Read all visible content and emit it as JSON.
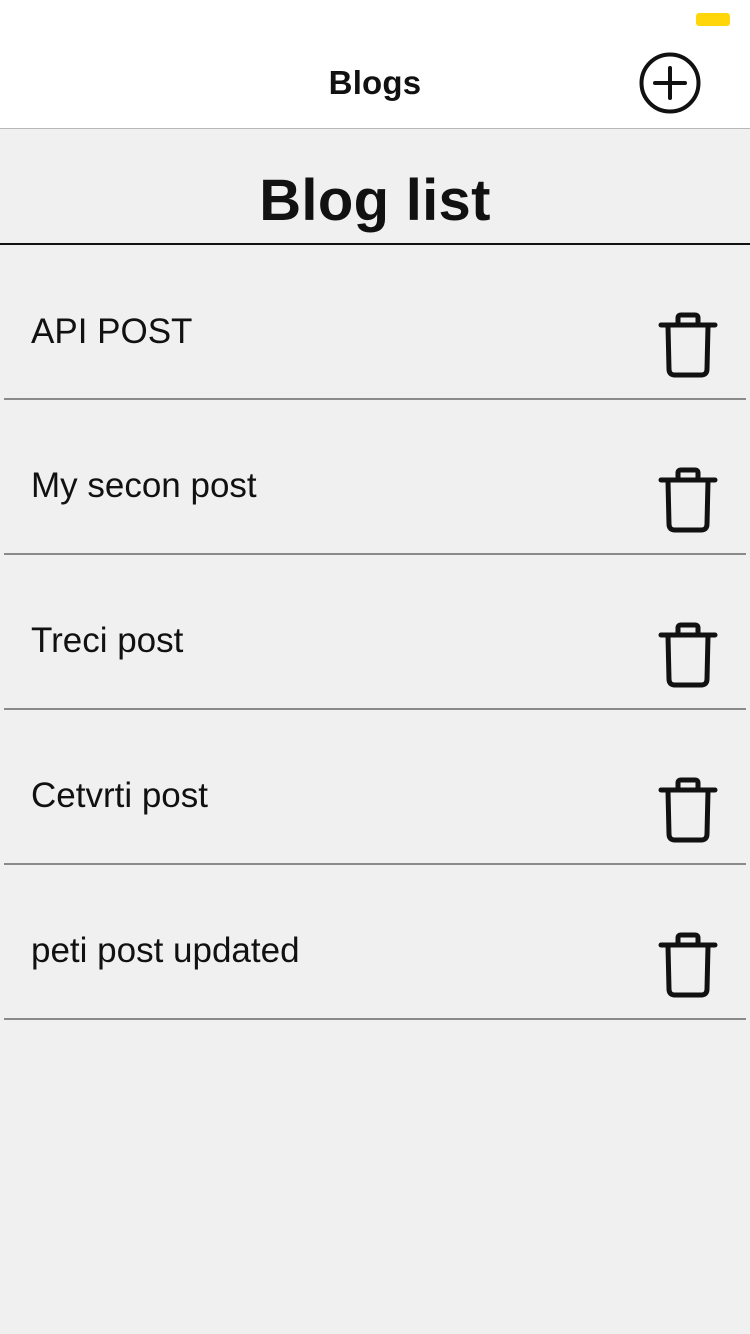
{
  "nav": {
    "title": "Blogs",
    "add_icon": "plus-circle-icon"
  },
  "header": {
    "title": "Blog list"
  },
  "posts": [
    {
      "title": "API POST",
      "delete_icon": "trash-icon"
    },
    {
      "title": "My secon post",
      "delete_icon": "trash-icon"
    },
    {
      "title": "Treci post",
      "delete_icon": "trash-icon"
    },
    {
      "title": "Cetvrti post",
      "delete_icon": "trash-icon"
    },
    {
      "title": "peti post updated",
      "delete_icon": "trash-icon"
    }
  ],
  "colors": {
    "background": "#f0f0f0",
    "nav_background": "#ffffff",
    "battery": "#ffd60a",
    "divider": "#8a8a8a",
    "text": "#111111"
  }
}
